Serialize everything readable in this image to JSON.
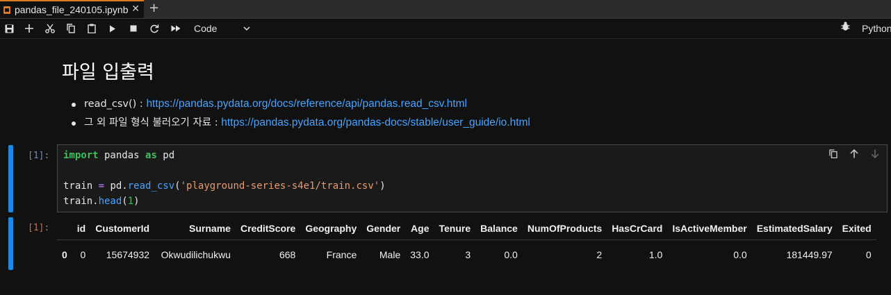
{
  "tab": {
    "title": "pandas_file_240105.ipynb",
    "close": "✕",
    "add": "+"
  },
  "toolbar": {
    "cell_type": "Code",
    "kernel": "Python",
    "icons": [
      "save-icon",
      "add-cell-icon",
      "cut-icon",
      "copy-icon",
      "paste-icon",
      "run-icon",
      "stop-icon",
      "restart-icon",
      "fast-forward-icon",
      "chevron-down-icon",
      "bug-icon"
    ]
  },
  "markdown": {
    "title": "파일 입출력",
    "items": [
      {
        "text": "read_csv() : ",
        "link": "https://pandas.pydata.org/docs/reference/api/pandas.read_csv.html"
      },
      {
        "text": "그 외 파일 형식 불러오기 자료 : ",
        "link": "https://pandas.pydata.org/pandas-docs/stable/user_guide/io.html"
      }
    ]
  },
  "code_cell": {
    "prompt": "[1]:",
    "lines": {
      "l1_kw1": "import",
      "l1_mod": " pandas ",
      "l1_kw2": "as",
      "l1_alias": " pd",
      "l3_var": "train ",
      "l3_eq": "=",
      "l3_pd": " pd.",
      "l3_fn": "read_csv",
      "l3_open": "(",
      "l3_str": "'playground-series-s4e1/train.csv'",
      "l3_close": ")",
      "l4_var": "train.",
      "l4_fn": "head",
      "l4_open": "(",
      "l4_num": "1",
      "l4_close": ")"
    }
  },
  "output_cell": {
    "prompt": "[1]:",
    "columns": [
      "",
      "id",
      "CustomerId",
      "Surname",
      "CreditScore",
      "Geography",
      "Gender",
      "Age",
      "Tenure",
      "Balance",
      "NumOfProducts",
      "HasCrCard",
      "IsActiveMember",
      "EstimatedSalary",
      "Exited"
    ],
    "rows": [
      [
        "0",
        "0",
        "15674932",
        "Okwudilichukwu",
        "668",
        "France",
        "Male",
        "33.0",
        "3",
        "0.0",
        "2",
        "1.0",
        "0.0",
        "181449.97",
        "0"
      ]
    ]
  },
  "colors": {
    "accent": "#1e88e5",
    "tab_accent": "#e07a1f",
    "link": "#4aa3ff",
    "keyword": "#3fbf5a",
    "string": "#e89a72"
  }
}
